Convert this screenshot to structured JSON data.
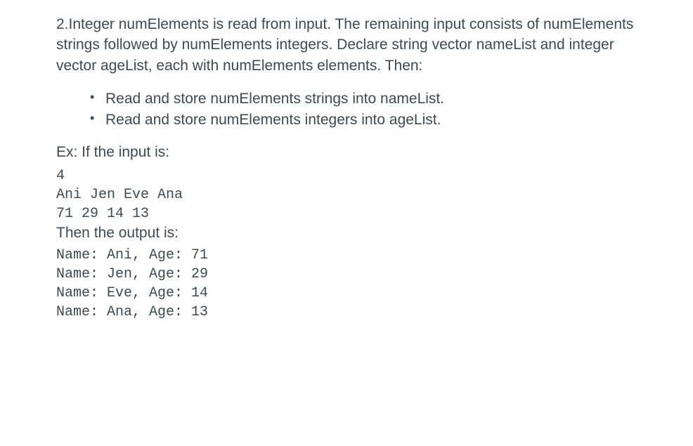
{
  "problem": {
    "description": "2.Integer numElements is read from input. The remaining input consists of numElements strings followed by numElements integers. Declare string vector nameList and integer vector ageList, each with numElements elements. Then:",
    "bullets": [
      "Read and store numElements strings into nameList.",
      "Read and store numElements integers into ageList."
    ],
    "input_label": "Ex: If the input is:",
    "input_example": "4\nAni Jen Eve Ana\n71 29 14 13",
    "output_label": "Then the output is:",
    "output_example": "Name: Ani, Age: 71\nName: Jen, Age: 29\nName: Eve, Age: 14\nName: Ana, Age: 13"
  }
}
